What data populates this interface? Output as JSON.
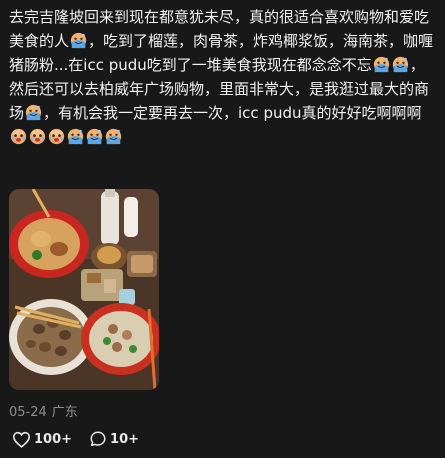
{
  "post": {
    "segments": [
      {
        "t": "text",
        "v": "去完吉隆坡回来到现在都意犹未尽，真的很适合喜欢购物和爱吃美食的人"
      },
      {
        "t": "emoji",
        "v": "sweat-smile-emoji"
      },
      {
        "t": "text",
        "v": "，吃到了榴莲，肉骨茶，炸鸡椰浆饭，海南茶，咖喱猪肠粉...在icc pudu吃到了一堆美食我现在都念念不忘"
      },
      {
        "t": "emoji",
        "v": "sweat-smile-emoji"
      },
      {
        "t": "emoji",
        "v": "sweat-smile-emoji"
      },
      {
        "t": "text",
        "v": "，然后还可以去柏威年广场购物，里面非常大，是我逛过最大的商场"
      },
      {
        "t": "emoji",
        "v": "sweat-smile-emoji"
      },
      {
        "t": "text",
        "v": "，有机会我一定要再去一次，icc pudu真的好好吃啊啊啊"
      },
      {
        "t": "emoji",
        "v": "crying-face-emoji"
      },
      {
        "t": "emoji",
        "v": "crying-face-emoji"
      },
      {
        "t": "emoji",
        "v": "crying-face-emoji"
      },
      {
        "t": "emoji",
        "v": "sweat-smile-emoji"
      },
      {
        "t": "emoji",
        "v": "sweat-smile-emoji"
      },
      {
        "t": "emoji",
        "v": "sweat-smile-emoji"
      }
    ],
    "media": {
      "icon": "food-photo",
      "description_hidden": true
    },
    "date": "05-24",
    "location": "广东",
    "likes": "100+",
    "comments": "10+"
  },
  "colors": {
    "background": "#181818",
    "text": "#f2f2f2",
    "meta": "#8e8e8e"
  }
}
